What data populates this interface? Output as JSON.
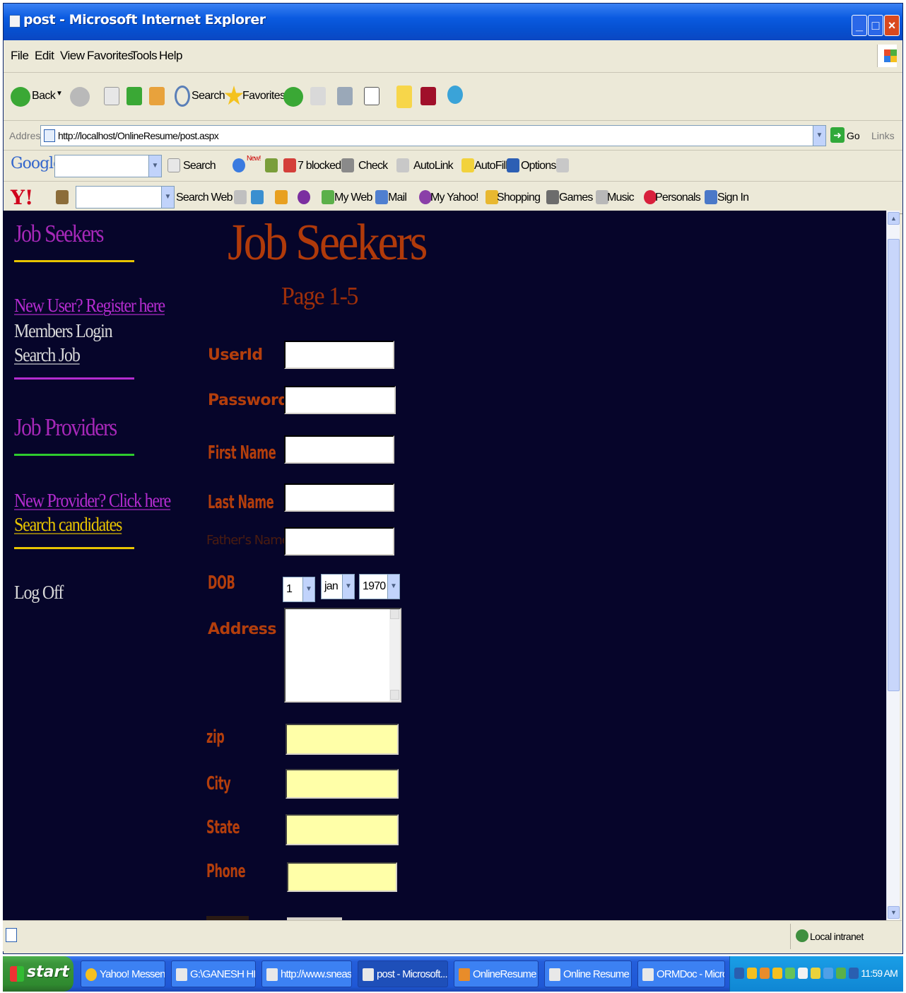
{
  "window": {
    "title": "post - Microsoft Internet Explorer"
  },
  "menu": [
    "File",
    "Edit",
    "View",
    "Favorites",
    "Tools",
    "Help"
  ],
  "toolbar": {
    "back": "Back",
    "search": "Search",
    "favorites": "Favorites"
  },
  "address": {
    "label": "Address",
    "url": "http://localhost/OnlineResume/post.aspx",
    "go": "Go",
    "links": "Links"
  },
  "google_bar": {
    "logo": "Google",
    "search": "Search",
    "new_badge": "New!",
    "blocked": "7 blocked",
    "check": "Check",
    "autolink": "AutoLink",
    "autofill": "AutoFill",
    "options": "Options"
  },
  "yahoo_bar": {
    "logo": "Y!",
    "search_web": "Search Web",
    "my_web": "My Web",
    "mail": "Mail",
    "my_yahoo": "My Yahoo!",
    "shopping": "Shopping",
    "games": "Games",
    "music": "Music",
    "personals": "Personals",
    "sign_in": "Sign In"
  },
  "sidebar": {
    "seekers_heading": "Job Seekers",
    "register": "New User? Register here",
    "members_login": "Members Login",
    "search_job": "Search Job",
    "providers_heading": "Job Providers",
    "new_provider": "New Provider? Click here",
    "search_candidates": "Search candidates",
    "log_off": "Log Off"
  },
  "form": {
    "title": "Job Seekers",
    "subtitle": "Page 1-5",
    "userid_label": "UserId",
    "password_label": "Password",
    "first_name_label": "First Name",
    "last_name_label": "Last Name",
    "father_name_label": "Father's Name",
    "dob_label": "DOB",
    "dob_day": "1",
    "dob_month": "jan",
    "dob_year": "1970",
    "address_label": "Address",
    "zip_label": "zip",
    "city_label": "City",
    "state_label": "State",
    "phone_label": "Phone"
  },
  "status": {
    "zone": "Local intranet"
  },
  "taskbar": {
    "start": "start",
    "tasks": [
      "Yahoo! Messen...",
      "G:\\GANESH HE...",
      "http://www.sneas...",
      "post - Microsoft...",
      "OnlineResume -...",
      "Online Resume ...",
      "ORMDoc - Micro..."
    ],
    "clock": "11:59 AM"
  },
  "colors": {
    "page_bg": "#06052a",
    "heading_orange": "#b03a0a",
    "nav_purple": "#a628b8",
    "line_yellow": "#e8c400",
    "line_green": "#2ecb2e",
    "field_yellow": "#ffffa8"
  }
}
